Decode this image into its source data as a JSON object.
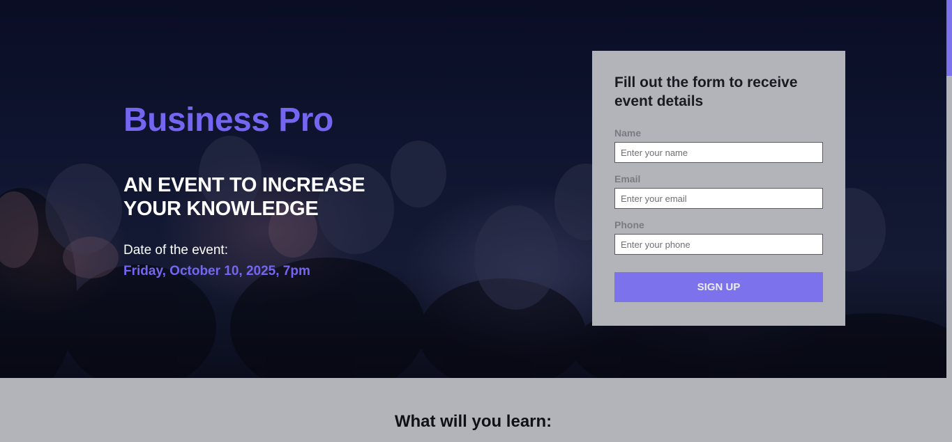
{
  "hero": {
    "brand": "Business Pro",
    "heading_line1": "AN EVENT TO INCREASE",
    "heading_line2": "YOUR KNOWLEDGE",
    "date_label": "Date of the event:",
    "date_value": "Friday, October 10, 2025, 7pm"
  },
  "form": {
    "title": "Fill out the form to receive event details",
    "fields": [
      {
        "label": "Name",
        "placeholder": "Enter your name",
        "value": ""
      },
      {
        "label": "Email",
        "placeholder": "Enter your email",
        "value": ""
      },
      {
        "label": "Phone",
        "placeholder": "Enter your phone",
        "value": ""
      }
    ],
    "submit_label": "SIGN UP"
  },
  "learn": {
    "title": "What will you learn:"
  },
  "colors": {
    "accent": "#7466f0",
    "button": "#7b72ec",
    "panel": "#b3b4b9",
    "hero_dark": "#0f1530"
  }
}
